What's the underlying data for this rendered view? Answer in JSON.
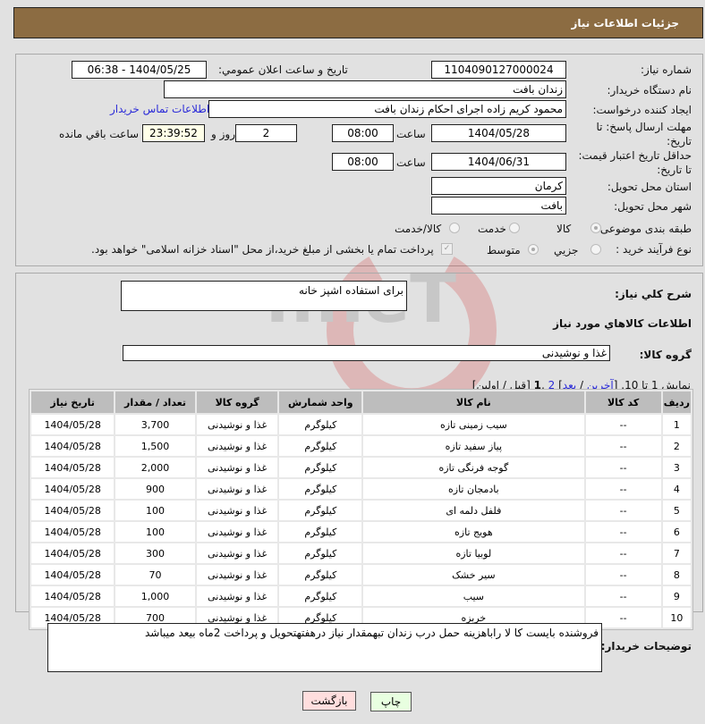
{
  "header": {
    "title": "جزئیات اطلاعات نیاز"
  },
  "form": {
    "need_number_label": "شماره نیاز:",
    "need_number": "1104090127000024",
    "announce_label": "تاریخ و ساعت اعلان عمومي:",
    "announce_value": "1404/05/25 - 06:38",
    "buyer_org_label": "نام دستگاه خریدار:",
    "buyer_org": "زندان بافت",
    "creator_label": "ایجاد کننده درخواست:",
    "creator": "محمود کریم زاده اجرای احکام زندان بافت",
    "contact_link": "اطلاعات تماس خریدار",
    "deadline_label": "مهلت ارسال پاسخ: تا تاریخ:",
    "deadline_date": "1404/05/28",
    "time_label": "ساعت",
    "deadline_time": "08:00",
    "days": "2",
    "days_label": "روز و",
    "remaining": "23:39:52",
    "remaining_label": "ساعت باقي مانده",
    "validity_label": "حداقل تاریخ اعتبار قیمت: تا تاریخ:",
    "validity_date": "1404/06/31",
    "validity_time": "08:00",
    "province_label": "استان محل تحویل:",
    "province": "کرمان",
    "city_label": "شهر محل تحویل:",
    "city": "بافت",
    "category_label": "طبقه بندی موضوعی:",
    "category_options": [
      "کالا",
      "خدمت",
      "کالا/خدمت"
    ],
    "process_label": "نوع فرآیند خرید :",
    "process_options": [
      "جزیي",
      "متوسط"
    ],
    "payment_note": "پرداخت تمام یا بخشی از مبلغ خرید،از محل \"اسناد خزانه اسلامی\" خواهد بود.",
    "description_label": "شرح کلي نیاز:",
    "description": "برای استفاده اشپز خانه",
    "goods_info_title": "اطلاعات کالاهاي مورد نیاز",
    "goods_group_label": "گروه کالا:",
    "goods_group": "غذا و نوشیدنی"
  },
  "pagination": {
    "prefix": "نمایش 1 تا 10. [",
    "last": "آخرین",
    "sep1": " / ",
    "next": "بعد",
    "mid": "] ",
    "p2": "2",
    "comma": " ,",
    "p1": "1",
    "suffix": " [قبل / اولین]"
  },
  "table": {
    "headers": [
      "ردیف",
      "کد کالا",
      "نام کالا",
      "واحد شمارش",
      "گروه کالا",
      "تعداد / مقدار",
      "تاریخ نیاز"
    ],
    "rows": [
      [
        "1",
        "--",
        "سیب زمینی تازه",
        "کیلوگرم",
        "غذا و نوشیدنی",
        "3,700",
        "1404/05/28"
      ],
      [
        "2",
        "--",
        "پیاز سفید تازه",
        "کیلوگرم",
        "غذا و نوشیدنی",
        "1,500",
        "1404/05/28"
      ],
      [
        "3",
        "--",
        "گوجه فرنگی تازه",
        "کیلوگرم",
        "غذا و نوشیدنی",
        "2,000",
        "1404/05/28"
      ],
      [
        "4",
        "--",
        "بادمجان تازه",
        "کیلوگرم",
        "غذا و نوشیدنی",
        "900",
        "1404/05/28"
      ],
      [
        "5",
        "--",
        "فلفل دلمه ای",
        "کیلوگرم",
        "غذا و نوشیدنی",
        "100",
        "1404/05/28"
      ],
      [
        "6",
        "--",
        "هویج تازه",
        "کیلوگرم",
        "غذا و نوشیدنی",
        "100",
        "1404/05/28"
      ],
      [
        "7",
        "--",
        "لوبیا تازه",
        "کیلوگرم",
        "غذا و نوشیدنی",
        "300",
        "1404/05/28"
      ],
      [
        "8",
        "--",
        "سیر خشک",
        "کیلوگرم",
        "غذا و نوشیدنی",
        "70",
        "1404/05/28"
      ],
      [
        "9",
        "--",
        "سیب",
        "کیلوگرم",
        "غذا و نوشیدنی",
        "1,000",
        "1404/05/28"
      ],
      [
        "10",
        "--",
        "خربزه",
        "کیلوگرم",
        "غذا و نوشیدنی",
        "700",
        "1404/05/28"
      ]
    ]
  },
  "notes": {
    "label": "توضیحات خریدار:",
    "text": "فروشنده بایست کا لا  راباهزینه حمل درب زندان تبهمقدار نیاز درهفتهتحویل و پرداخت 2ماه بیعد  میباشد"
  },
  "buttons": {
    "print": "چاپ",
    "back": "بازگشت"
  }
}
